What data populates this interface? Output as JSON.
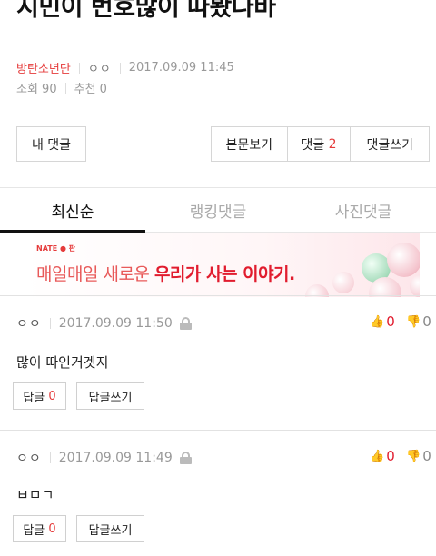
{
  "post": {
    "title": "지민이 번호많이 따봤나바",
    "category": "방탄소년단",
    "author": "ㅇㅇ",
    "datetime": "2017.09.09 11:45",
    "views_label": "조회 90",
    "recommend_label": "추천 0"
  },
  "toolbar": {
    "my_comments": "내 댓글",
    "view_post": "본문보기",
    "comments_label": "댓글",
    "comments_count": "2",
    "write_comment": "댓글쓰기"
  },
  "tabs": [
    {
      "label": "최신순",
      "active": true
    },
    {
      "label": "랭킹댓글",
      "active": false
    },
    {
      "label": "사진댓글",
      "active": false
    }
  ],
  "banner": {
    "brand": "NATE ● 판",
    "slogan_plain": "매일매일 새로운 ",
    "slogan_bold": "우리가 사는 이야기."
  },
  "comments": [
    {
      "author": "ㅇㅇ",
      "datetime": "2017.09.09 11:50",
      "likes": "0",
      "dislikes": "0",
      "text": "많이 따인거겟지",
      "reply_label": "답글",
      "reply_count": "0",
      "write_reply": "답글쓰기"
    },
    {
      "author": "ㅇㅇ",
      "datetime": "2017.09.09 11:49",
      "likes": "0",
      "dislikes": "0",
      "text": "ㅂㅁㄱ",
      "reply_label": "답글",
      "reply_count": "0",
      "write_reply": "답글쓰기"
    }
  ],
  "colors": {
    "accent_red": "#e53b3b",
    "like_red": "#e11c2e",
    "dislike_gray": "#888888"
  },
  "icons": [
    "lock-icon",
    "thumbs-up-icon",
    "thumbs-down-icon"
  ]
}
